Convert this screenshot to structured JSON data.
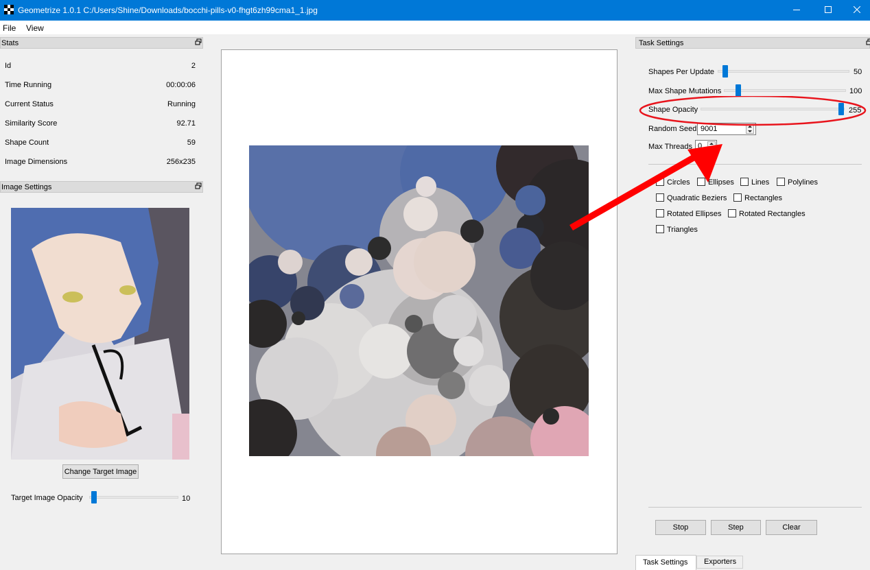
{
  "window": {
    "title": "Geometrize 1.0.1 C:/Users/Shine/Downloads/bocchi-pills-v0-fhgt6zh99cma1_1.jpg"
  },
  "menu": [
    "File",
    "View"
  ],
  "stats": {
    "panel_title": "Stats",
    "rows": [
      {
        "label": "Id",
        "value": "2"
      },
      {
        "label": "Time Running",
        "value": "00:00:06"
      },
      {
        "label": "Current Status",
        "value": "Running"
      },
      {
        "label": "Similarity Score",
        "value": "92.71"
      },
      {
        "label": "Shape Count",
        "value": "59"
      },
      {
        "label": "Image Dimensions",
        "value": "256x235"
      }
    ]
  },
  "image_settings": {
    "panel_title": "Image Settings",
    "change_button": "Change Target Image",
    "opacity_label": "Target Image Opacity",
    "opacity_value": "10",
    "opacity_fraction": 0.04
  },
  "task_settings": {
    "panel_title": "Task Settings",
    "shapes_per_update": {
      "label": "Shapes Per Update",
      "value": "50",
      "fraction": 0.04
    },
    "max_shape_mutations": {
      "label": "Max Shape Mutations",
      "value": "100",
      "fraction": 0.1
    },
    "shape_opacity": {
      "label": "Shape Opacity",
      "value": "255",
      "fraction": 1.0
    },
    "random_seed": {
      "label": "Random Seed",
      "value": "9001"
    },
    "max_threads": {
      "label": "Max Threads",
      "value": "0"
    },
    "shape_types": [
      {
        "label": "Circles",
        "checked": false
      },
      {
        "label": "Ellipses",
        "checked": false
      },
      {
        "label": "Lines",
        "checked": false
      },
      {
        "label": "Polylines",
        "checked": false
      },
      {
        "label": "Quadratic Beziers",
        "checked": false
      },
      {
        "label": "Rectangles",
        "checked": false
      },
      {
        "label": "Rotated Ellipses",
        "checked": false
      },
      {
        "label": "Rotated Rectangles",
        "checked": false
      },
      {
        "label": "Triangles",
        "checked": false
      }
    ],
    "buttons": {
      "stop": "Stop",
      "step": "Step",
      "clear": "Clear"
    }
  },
  "bottom_tabs": [
    {
      "label": "Task Settings",
      "active": true
    },
    {
      "label": "Exporters",
      "active": false
    }
  ],
  "colors": {
    "titlebar": "#0078d7",
    "annotation": "#ff0000",
    "slider_handle": "#0078d7"
  }
}
